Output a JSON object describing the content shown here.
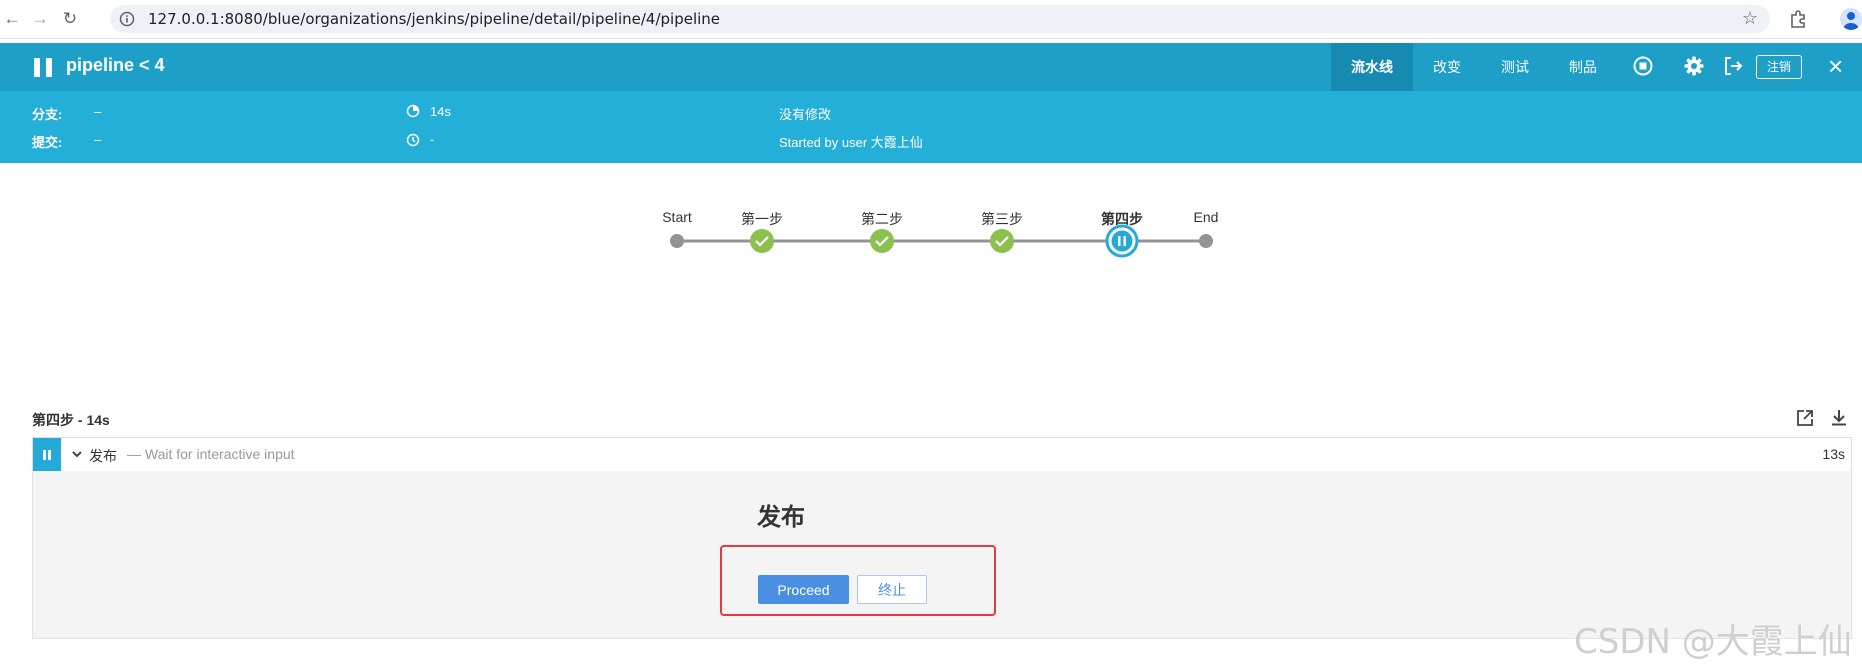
{
  "browser": {
    "url": "127.0.0.1:8080/blue/organizations/jenkins/pipeline/detail/pipeline/4/pipeline"
  },
  "header": {
    "title": "pipeline < 4",
    "tabs": [
      "流水线",
      "改变",
      "测试",
      "制品"
    ],
    "logout_label": "注销"
  },
  "summary": {
    "branch_label": "分支:",
    "branch_value": "–",
    "commit_label": "提交:",
    "commit_value": "–",
    "duration": "14s",
    "time_ago": "-",
    "changes": "没有修改",
    "started_by": "Started by user 大霞上仙"
  },
  "pipeline_graph": {
    "stages": [
      {
        "label": "Start",
        "status": "start"
      },
      {
        "label": "第一步",
        "status": "success"
      },
      {
        "label": "第二步",
        "status": "success"
      },
      {
        "label": "第三步",
        "status": "success"
      },
      {
        "label": "第四步",
        "status": "paused"
      },
      {
        "label": "End",
        "status": "end"
      }
    ]
  },
  "step_panel": {
    "title": "第四步 - 14s",
    "step_name": "发布",
    "step_desc": "— Wait for interactive input",
    "step_time": "13s"
  },
  "input_prompt": {
    "title": "发布",
    "proceed_label": "Proceed",
    "abort_label": "终止"
  },
  "watermark": "CSDN @大霞上仙",
  "colors": {
    "header_bg": "#1e9fc8",
    "subheader_bg": "#24afd8",
    "success": "#8cc04f",
    "paused": "#24a9d9",
    "primary": "#4a90e2",
    "highlight_box": "#e53b3b"
  }
}
